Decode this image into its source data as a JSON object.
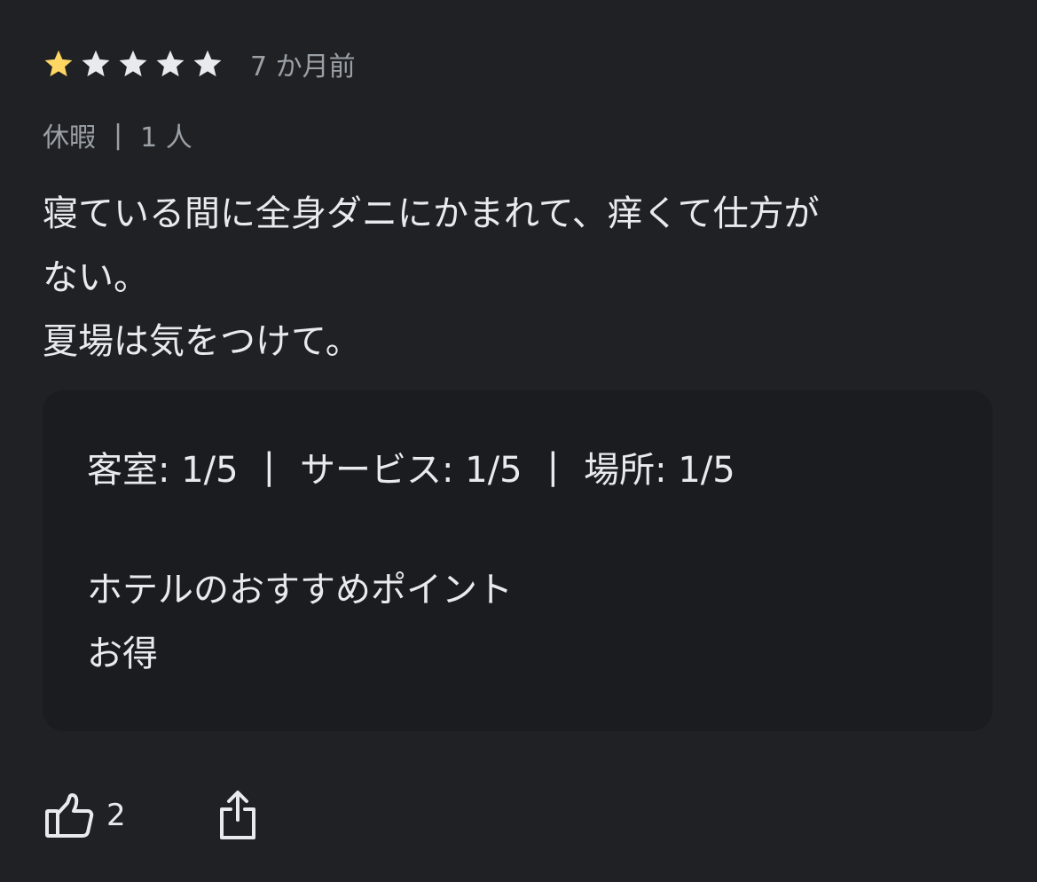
{
  "review": {
    "rating": 1,
    "rating_max": 5,
    "star_filled_color": "#fdd663",
    "star_empty_color": "#e8eaed",
    "date": "7 か月前",
    "trip_type": "休暇",
    "trip_separator": "|",
    "party": "1 人",
    "body_lines": [
      "寝ている間に全身ダニにかまれて、痒くて仕方が",
      "ない。",
      "夏場は気をつけて。"
    ]
  },
  "card": {
    "scores": [
      {
        "label": "客室: 1/5"
      },
      {
        "label": "サービス: 1/5"
      },
      {
        "label": "場所: 1/5"
      }
    ],
    "separator": "|",
    "recommend_heading": "ホテルのおすすめポイント",
    "recommend_item": "お得"
  },
  "actions": {
    "like_icon": "thumbs-up-icon",
    "like_count": "2",
    "share_icon": "share-icon"
  }
}
